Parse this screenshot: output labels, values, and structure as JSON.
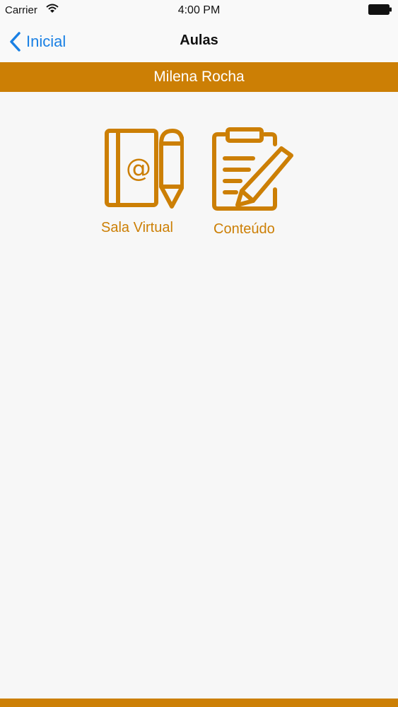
{
  "status_bar": {
    "carrier": "Carrier",
    "time": "4:00 PM"
  },
  "nav": {
    "back_label": "Inicial",
    "title": "Aulas"
  },
  "user": {
    "name": "Milena Rocha"
  },
  "tiles": [
    {
      "label": "Sala Virtual",
      "icon": "address-book-pencil-icon"
    },
    {
      "label": "Conteúdo",
      "icon": "clipboard-edit-icon"
    }
  ],
  "colors": {
    "accent": "#cc7f05",
    "link": "#1a80e4",
    "background": "#f7f7f7"
  }
}
